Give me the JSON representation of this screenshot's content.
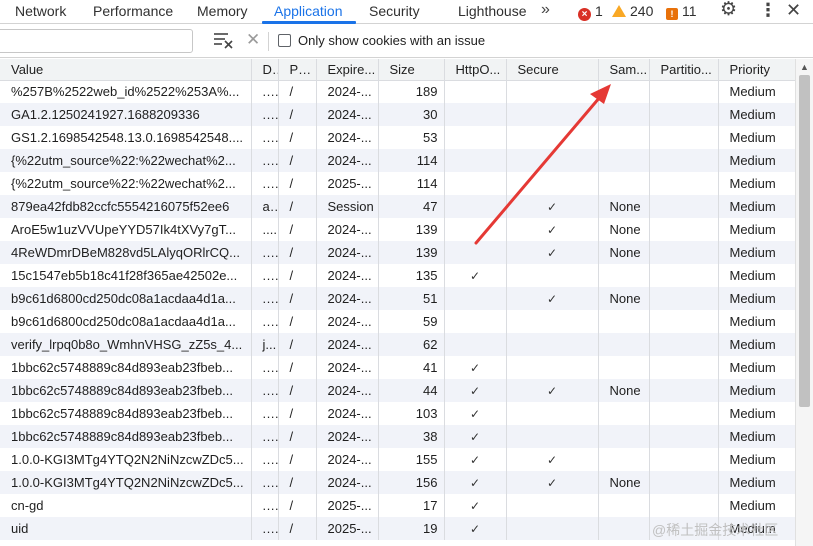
{
  "tabs": [
    {
      "label": "Network",
      "active": false
    },
    {
      "label": "Performance",
      "active": false
    },
    {
      "label": "Memory",
      "active": false
    },
    {
      "label": "Application",
      "active": true
    },
    {
      "label": "Security",
      "active": false
    },
    {
      "label": "Lighthouse",
      "active": false
    }
  ],
  "more_tabs_icon": "chevron-double-right-icon",
  "issues": {
    "errors": "1",
    "warnings": "240",
    "info": "11",
    "error_color": "#d93025",
    "warning_color": "#f9a825",
    "info_color": "#e8710a"
  },
  "toolbar": {
    "filter_value": "",
    "only_issue_label": "Only show cookies with an issue",
    "only_issue_checked": false
  },
  "accent_color": "#1a73e8",
  "table": {
    "columns": [
      "Value",
      "D...",
      "Path",
      "Expire...",
      "Size",
      "HttpO...",
      "Secure",
      "Sam...",
      "Partitio...",
      "Priority"
    ],
    "rows": [
      [
        "%257B%2522web_id%2522%253A%...",
        ".j...",
        "/",
        "2024-...",
        "189",
        "",
        "",
        "",
        "",
        "Medium"
      ],
      [
        "GA1.2.1250241927.1688209336",
        ".j...",
        "/",
        "2024-...",
        "30",
        "",
        "",
        "",
        "",
        "Medium"
      ],
      [
        "GS1.2.1698542548.13.0.1698542548....",
        ".j...",
        "/",
        "2024-...",
        "53",
        "",
        "",
        "",
        "",
        "Medium"
      ],
      [
        "{%22utm_source%22:%22wechat%2...",
        ".j...",
        "/",
        "2024-...",
        "114",
        "",
        "",
        "",
        "",
        "Medium"
      ],
      [
        "{%22utm_source%22:%22wechat%2...",
        ".j...",
        "/",
        "2025-...",
        "114",
        "",
        "",
        "",
        "",
        "Medium"
      ],
      [
        "879ea42fdb82ccfc5554216075f52ee6",
        "a...",
        "/",
        "Session",
        "47",
        "",
        "✓",
        "None",
        "",
        "Medium"
      ],
      [
        "AroE5w1uzVVUpeYYD57Ik4tXVy7gT...",
        "....",
        "/",
        "2024-...",
        "139",
        "",
        "✓",
        "None",
        "",
        "Medium"
      ],
      [
        "4ReWDmrDBeM828vd5LAlyqORlrCQ...",
        ".j...",
        "/",
        "2024-...",
        "139",
        "",
        "✓",
        "None",
        "",
        "Medium"
      ],
      [
        "15c1547eb5b18c41f28f365ae42502e...",
        ".j...",
        "/",
        "2024-...",
        "135",
        "✓",
        "",
        "",
        "",
        "Medium"
      ],
      [
        "b9c61d6800cd250dc08a1acdaa4d1a...",
        ".j...",
        "/",
        "2024-...",
        "51",
        "",
        "✓",
        "None",
        "",
        "Medium"
      ],
      [
        "b9c61d6800cd250dc08a1acdaa4d1a...",
        ".j...",
        "/",
        "2024-...",
        "59",
        "",
        "",
        "",
        "",
        "Medium"
      ],
      [
        "verify_lrpq0b8o_WmhnVHSG_zZ5s_4...",
        "j...",
        "/",
        "2024-...",
        "62",
        "",
        "",
        "",
        "",
        "Medium"
      ],
      [
        "1bbc62c5748889c84d893eab23fbeb...",
        ".j...",
        "/",
        "2024-...",
        "41",
        "✓",
        "",
        "",
        "",
        "Medium"
      ],
      [
        "1bbc62c5748889c84d893eab23fbeb...",
        ".j...",
        "/",
        "2024-...",
        "44",
        "✓",
        "✓",
        "None",
        "",
        "Medium"
      ],
      [
        "1bbc62c5748889c84d893eab23fbeb...",
        ".j...",
        "/",
        "2024-...",
        "103",
        "✓",
        "",
        "",
        "",
        "Medium"
      ],
      [
        "1bbc62c5748889c84d893eab23fbeb...",
        ".j...",
        "/",
        "2024-...",
        "38",
        "✓",
        "",
        "",
        "",
        "Medium"
      ],
      [
        "1.0.0-KGI3MTg4YTQ2N2NiNzcwZDc5...",
        ".j...",
        "/",
        "2024-...",
        "155",
        "✓",
        "✓",
        "",
        "",
        "Medium"
      ],
      [
        "1.0.0-KGI3MTg4YTQ2N2NiNzcwZDc5...",
        ".j...",
        "/",
        "2024-...",
        "156",
        "✓",
        "✓",
        "None",
        "",
        "Medium"
      ],
      [
        "cn-gd",
        ".j...",
        "/",
        "2025-...",
        "17",
        "✓",
        "",
        "",
        "",
        "Medium"
      ],
      [
        "uid",
        ".j...",
        "/",
        "2025-...",
        "19",
        "✓",
        "",
        "",
        "",
        "Medium"
      ]
    ]
  },
  "annotation_color": "#e53935",
  "watermark": "@稀土掘金技术社区"
}
